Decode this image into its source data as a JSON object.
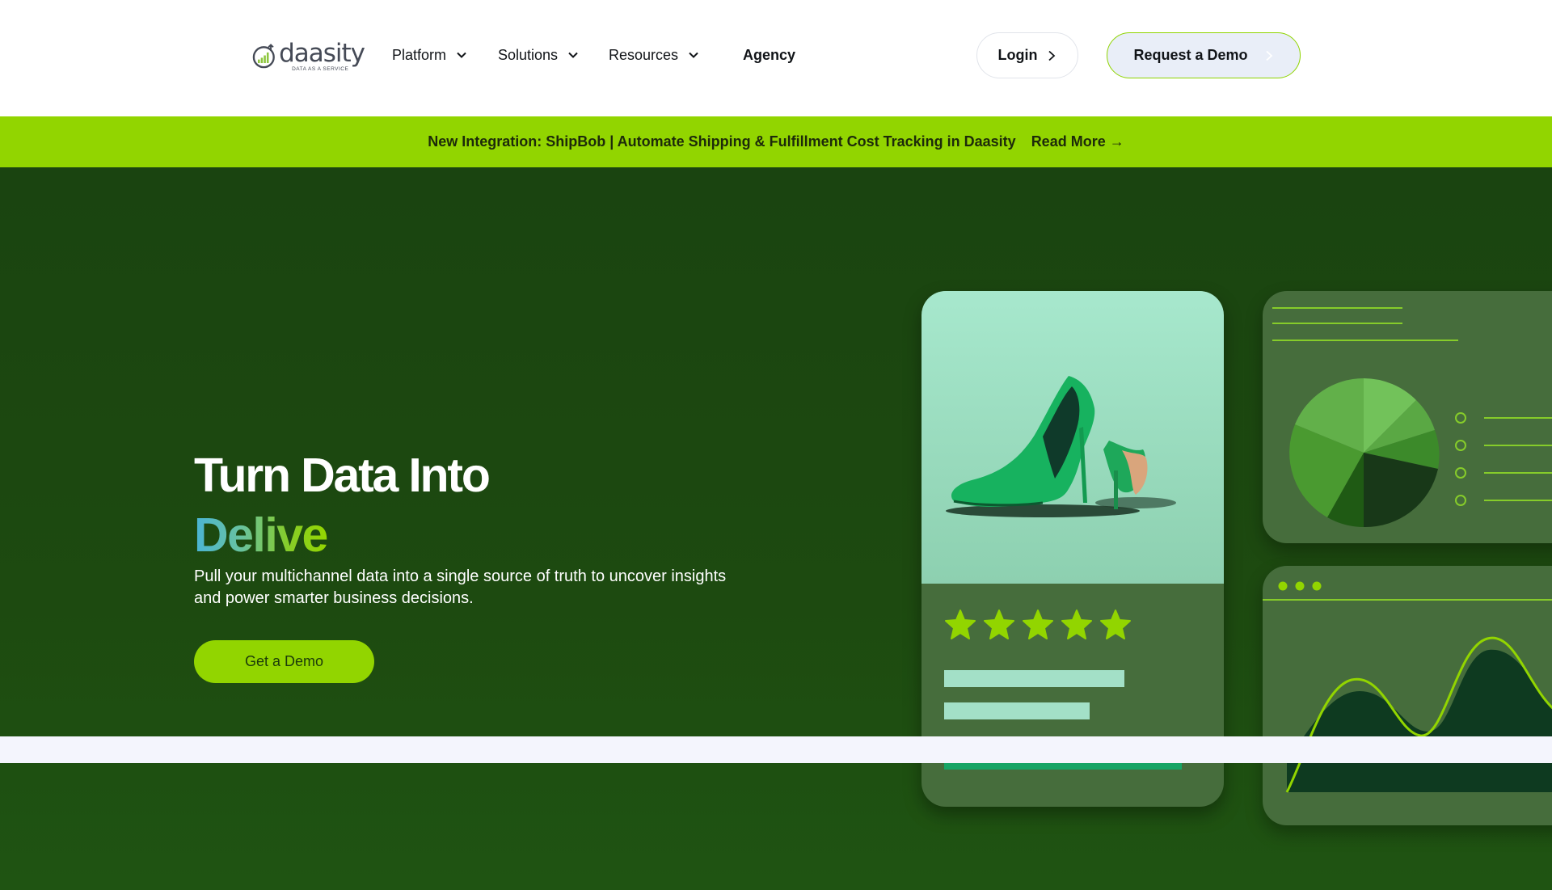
{
  "header": {
    "logo": {
      "word": "daasity",
      "tagline": "DATA AS A SERVICE"
    },
    "nav": [
      {
        "label": "Platform",
        "has_dropdown": true
      },
      {
        "label": "Solutions",
        "has_dropdown": true
      },
      {
        "label": "Resources",
        "has_dropdown": true
      },
      {
        "label": "Agency",
        "has_dropdown": false
      }
    ],
    "login_label": "Login",
    "demo_label": "Request a Demo"
  },
  "announcement": {
    "text": "New Integration: ShipBob | Automate Shipping & Fulfillment Cost Tracking in Daasity",
    "link_label": "Read More →"
  },
  "hero": {
    "title": "Turn Data Into",
    "rotating_word": "Delive",
    "subtitle": "Pull your multichannel data into a single source of truth to uncover insights and power smarter business decisions.",
    "cta_label": "Get a Demo"
  },
  "illustration": {
    "rating_stars": 5,
    "icons": [
      "high-heel-shoes-image",
      "star-icon",
      "pie-chart",
      "area-chart"
    ]
  },
  "colors": {
    "brand_green": "#92d500",
    "hero_bg": "#1a4410",
    "card_bg": "#466d3c",
    "product_bg": "#a7e8cd"
  }
}
